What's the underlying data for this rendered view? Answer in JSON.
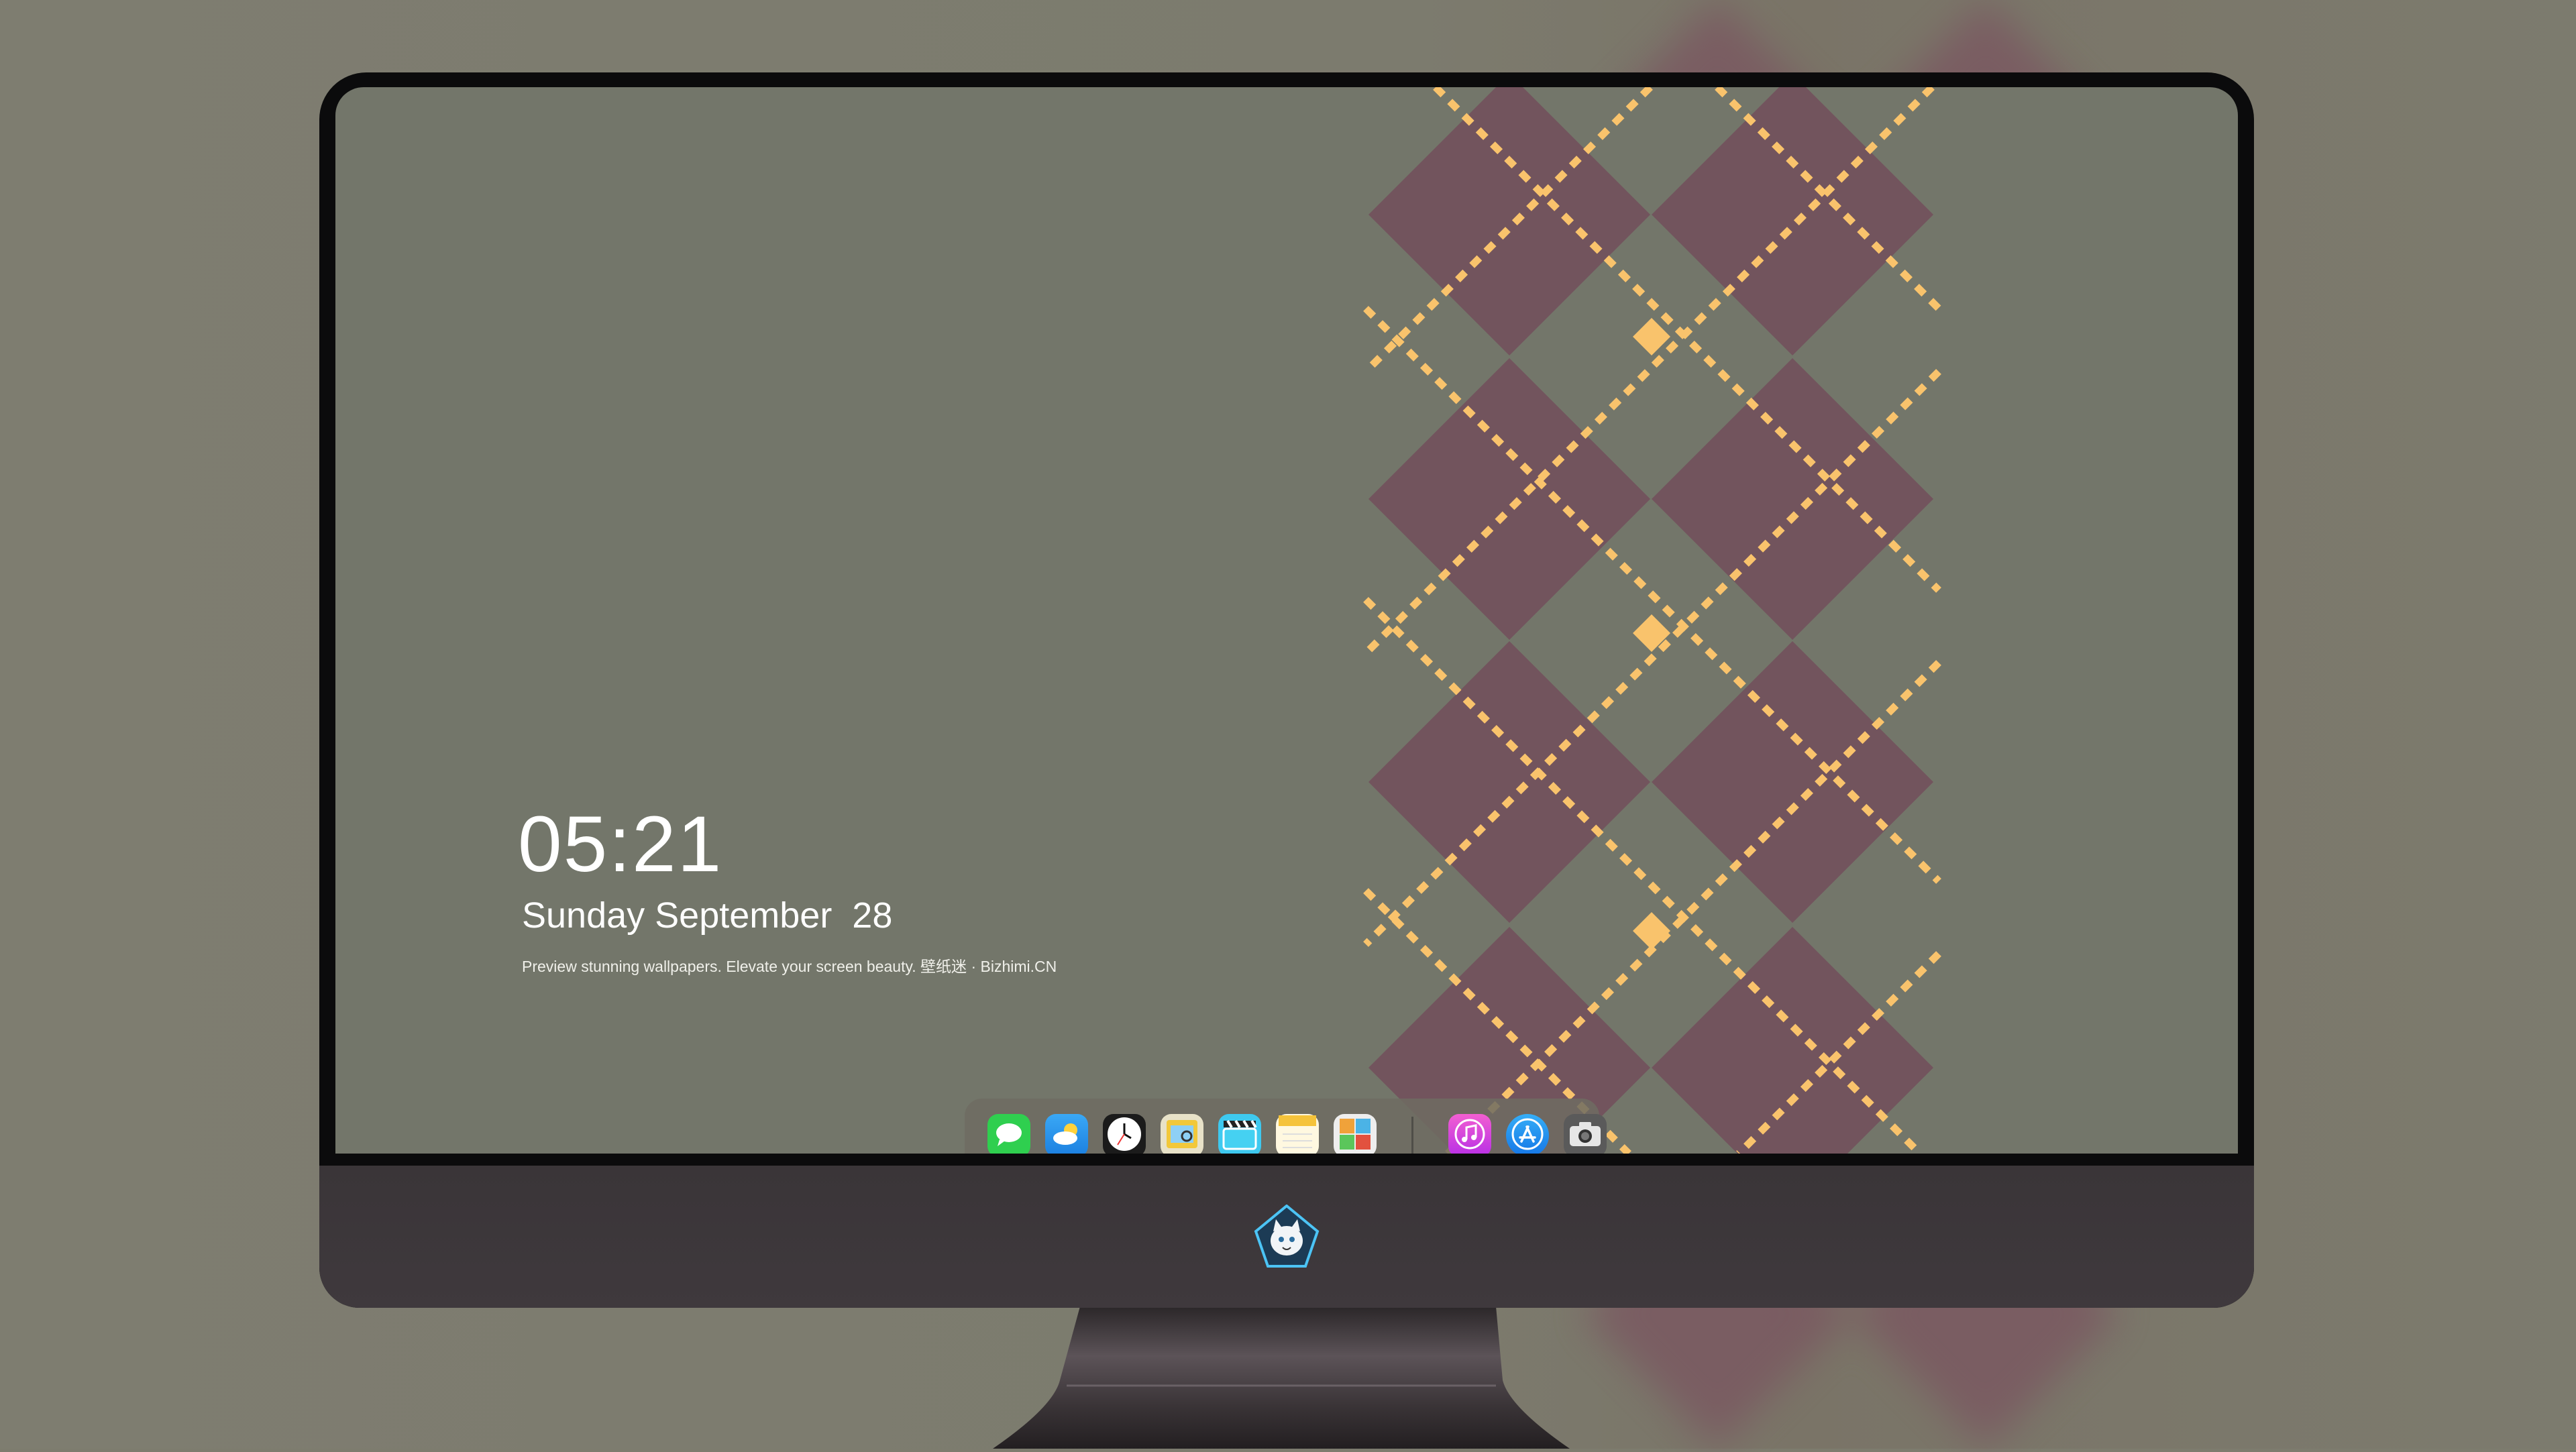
{
  "lockscreen": {
    "time": "05:21",
    "date": "Sunday September  28",
    "tagline": "Preview stunning wallpapers. Elevate your screen beauty. 壁纸迷 · Bizhimi.CN"
  },
  "dock": {
    "apps": [
      {
        "name": "messages",
        "icon": "message-bubble-icon",
        "color": "#2fcf4f"
      },
      {
        "name": "weather",
        "icon": "weather-cloud-icon",
        "color": "#2e9bf0"
      },
      {
        "name": "clock",
        "icon": "clock-icon",
        "color": "#1b1b1b"
      },
      {
        "name": "preview",
        "icon": "preview-icon",
        "color": "#f2c83a"
      },
      {
        "name": "clips",
        "icon": "clapperboard-icon",
        "color": "#3ec9ef"
      },
      {
        "name": "notes",
        "icon": "notes-icon",
        "color": "#f5c33b"
      },
      {
        "name": "photo-booth",
        "icon": "photo-grid-icon",
        "color": "#eeeeee"
      },
      {
        "name": "music",
        "icon": "music-note-icon",
        "color": "#d43de6"
      },
      {
        "name": "app-store",
        "icon": "app-store-icon",
        "color": "#1f8ef1"
      },
      {
        "name": "screenshot",
        "icon": "camera-icon",
        "color": "#5a5a5a"
      }
    ]
  },
  "wallpaper": {
    "background": "#73766a",
    "diamond_color": "#72545d",
    "dash_color": "#f9c36c"
  },
  "monitor": {
    "bezel_color": "#0b0b0c",
    "chin_color": "#3d373b",
    "logo_icon": "cat-mascot-logo-icon"
  }
}
